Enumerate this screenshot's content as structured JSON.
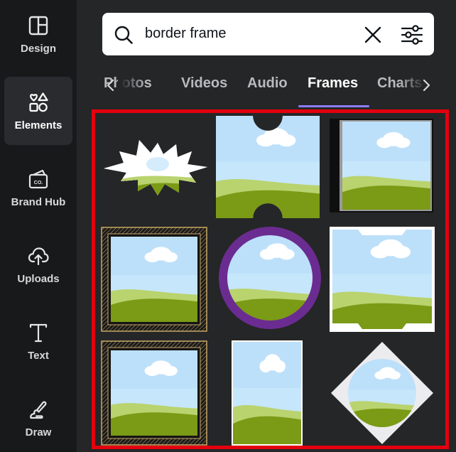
{
  "sidebar": {
    "items": [
      {
        "label": "Design",
        "icon": "layout-icon",
        "active": false
      },
      {
        "label": "Elements",
        "icon": "shapes-icon",
        "active": true
      },
      {
        "label": "Brand Hub",
        "icon": "brand-hub-icon",
        "active": false
      },
      {
        "label": "Uploads",
        "icon": "cloud-upload-icon",
        "active": false
      },
      {
        "label": "Text",
        "icon": "text-icon",
        "active": false
      },
      {
        "label": "Draw",
        "icon": "draw-icon",
        "active": false
      }
    ]
  },
  "search": {
    "value": "border frame",
    "icon": "search-icon",
    "clear_icon": "close-icon",
    "filter_icon": "filter-sliders-icon"
  },
  "tabs": {
    "items": [
      "Photos",
      "Videos",
      "Audio",
      "Frames",
      "Charts"
    ],
    "active": "Frames"
  },
  "results": {
    "frames": [
      {
        "name": "starburst-frame",
        "shape": "starburst"
      },
      {
        "name": "ticket-notch-frame",
        "shape": "notched-rectangle"
      },
      {
        "name": "black-edge-frame",
        "shape": "rectangle-dark-border"
      },
      {
        "name": "gold-ornate-frame",
        "shape": "ornate-square"
      },
      {
        "name": "purple-circle-frame",
        "shape": "circle-ring",
        "color": "#6b2c91"
      },
      {
        "name": "white-notched-frame",
        "shape": "notched-white"
      },
      {
        "name": "gold-ornate-frame-2",
        "shape": "ornate-rectangle"
      },
      {
        "name": "white-portrait-frame",
        "shape": "white-rectangle"
      },
      {
        "name": "diamond-circle-frame",
        "shape": "diamond"
      }
    ]
  },
  "colors": {
    "accent": "#8b7cf6",
    "highlight": "#e3000f",
    "sky": "#c6e6fb",
    "grass_light": "#b9d36e",
    "grass_dark": "#7b9a16",
    "gold": "#c9a968",
    "purple": "#6b2c91"
  }
}
